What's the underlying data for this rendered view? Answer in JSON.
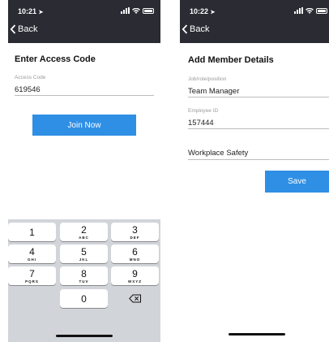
{
  "left": {
    "status": {
      "time": "10:21"
    },
    "nav": {
      "back_label": "Back"
    },
    "title": "Enter Access Code",
    "access_code": {
      "label": "Access Code",
      "value": "619546"
    },
    "join_label": "Join Now",
    "keypad": [
      {
        "digit": "1",
        "letters": ""
      },
      {
        "digit": "2",
        "letters": "ABC"
      },
      {
        "digit": "3",
        "letters": "DEF"
      },
      {
        "digit": "4",
        "letters": "GHI"
      },
      {
        "digit": "5",
        "letters": "JKL"
      },
      {
        "digit": "6",
        "letters": "MNO"
      },
      {
        "digit": "7",
        "letters": "PQRS"
      },
      {
        "digit": "8",
        "letters": "TUV"
      },
      {
        "digit": "9",
        "letters": "WXYZ"
      },
      {
        "digit": "0",
        "letters": ""
      }
    ]
  },
  "right": {
    "status": {
      "time": "10:22"
    },
    "nav": {
      "back_label": "Back"
    },
    "title": "Add Member Details",
    "job": {
      "label": "Job/role/position",
      "value": "Team Manager"
    },
    "employee": {
      "label": "Employee ID",
      "value": "157444"
    },
    "workplace": {
      "value": "Workplace Safety"
    },
    "save_label": "Save"
  },
  "colors": {
    "accent": "#2f8fe5",
    "header_bg": "#2a2b33",
    "keypad_bg": "#d1d4d9"
  },
  "icons": [
    "location-arrow-icon",
    "signal-icon",
    "wifi-icon",
    "battery-icon",
    "chevron-left-icon",
    "backspace-icon"
  ]
}
